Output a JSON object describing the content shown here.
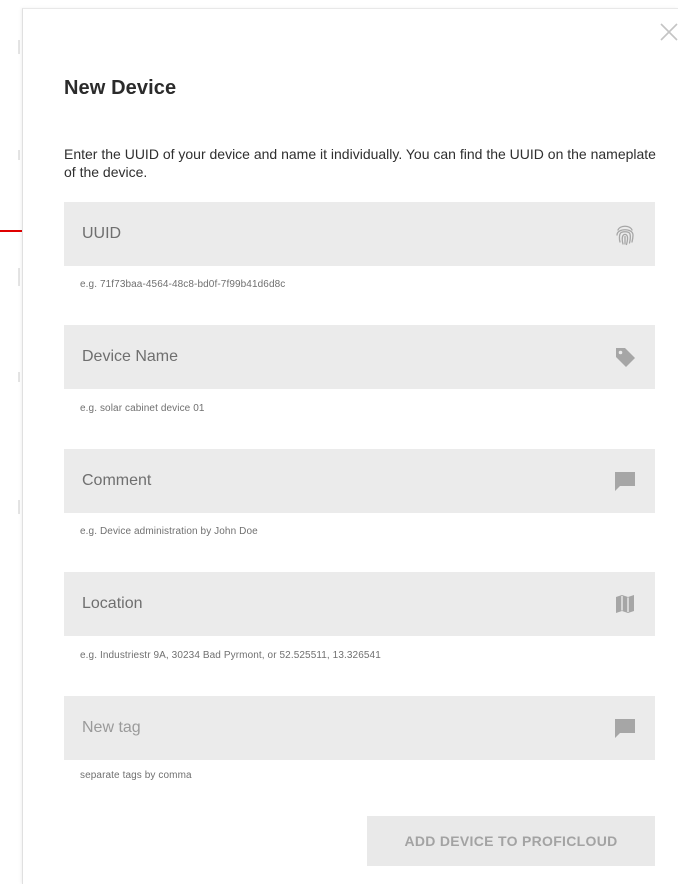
{
  "dialog": {
    "title": "New Device",
    "description": "Enter the UUID of your device and name it individually. You can find the UUID on the nameplate of the device.",
    "close_icon": "close-icon"
  },
  "fields": {
    "uuid": {
      "placeholder": "UUID",
      "value": "",
      "hint": "e.g. 71f73baa-4564-48c8-bd0f-7f99b41d6d8c",
      "icon": "fingerprint-icon"
    },
    "device_name": {
      "placeholder": "Device Name",
      "value": "",
      "hint": "e.g. solar cabinet device 01",
      "icon": "tag-icon"
    },
    "comment": {
      "placeholder": "Comment",
      "value": "",
      "hint": "e.g. Device administration by John Doe",
      "icon": "comment-icon"
    },
    "location": {
      "placeholder": "Location",
      "value": "",
      "hint": "e.g. Industriestr 9A, 30234 Bad Pyrmont, or 52.525511, 13.326541",
      "icon": "map-icon"
    },
    "new_tag": {
      "placeholder": "New tag",
      "value": "",
      "hint": "separate tags by comma",
      "icon": "comment-icon"
    }
  },
  "submit": {
    "label": "ADD DEVICE TO PROFICLOUD",
    "state": "disabled"
  },
  "colors": {
    "field_background": "#ebebeb",
    "icon": "#a6a6a6",
    "button_background": "#e9e9e9",
    "button_text": "#a3a3a3",
    "annotation_arrow": "#e00000"
  }
}
